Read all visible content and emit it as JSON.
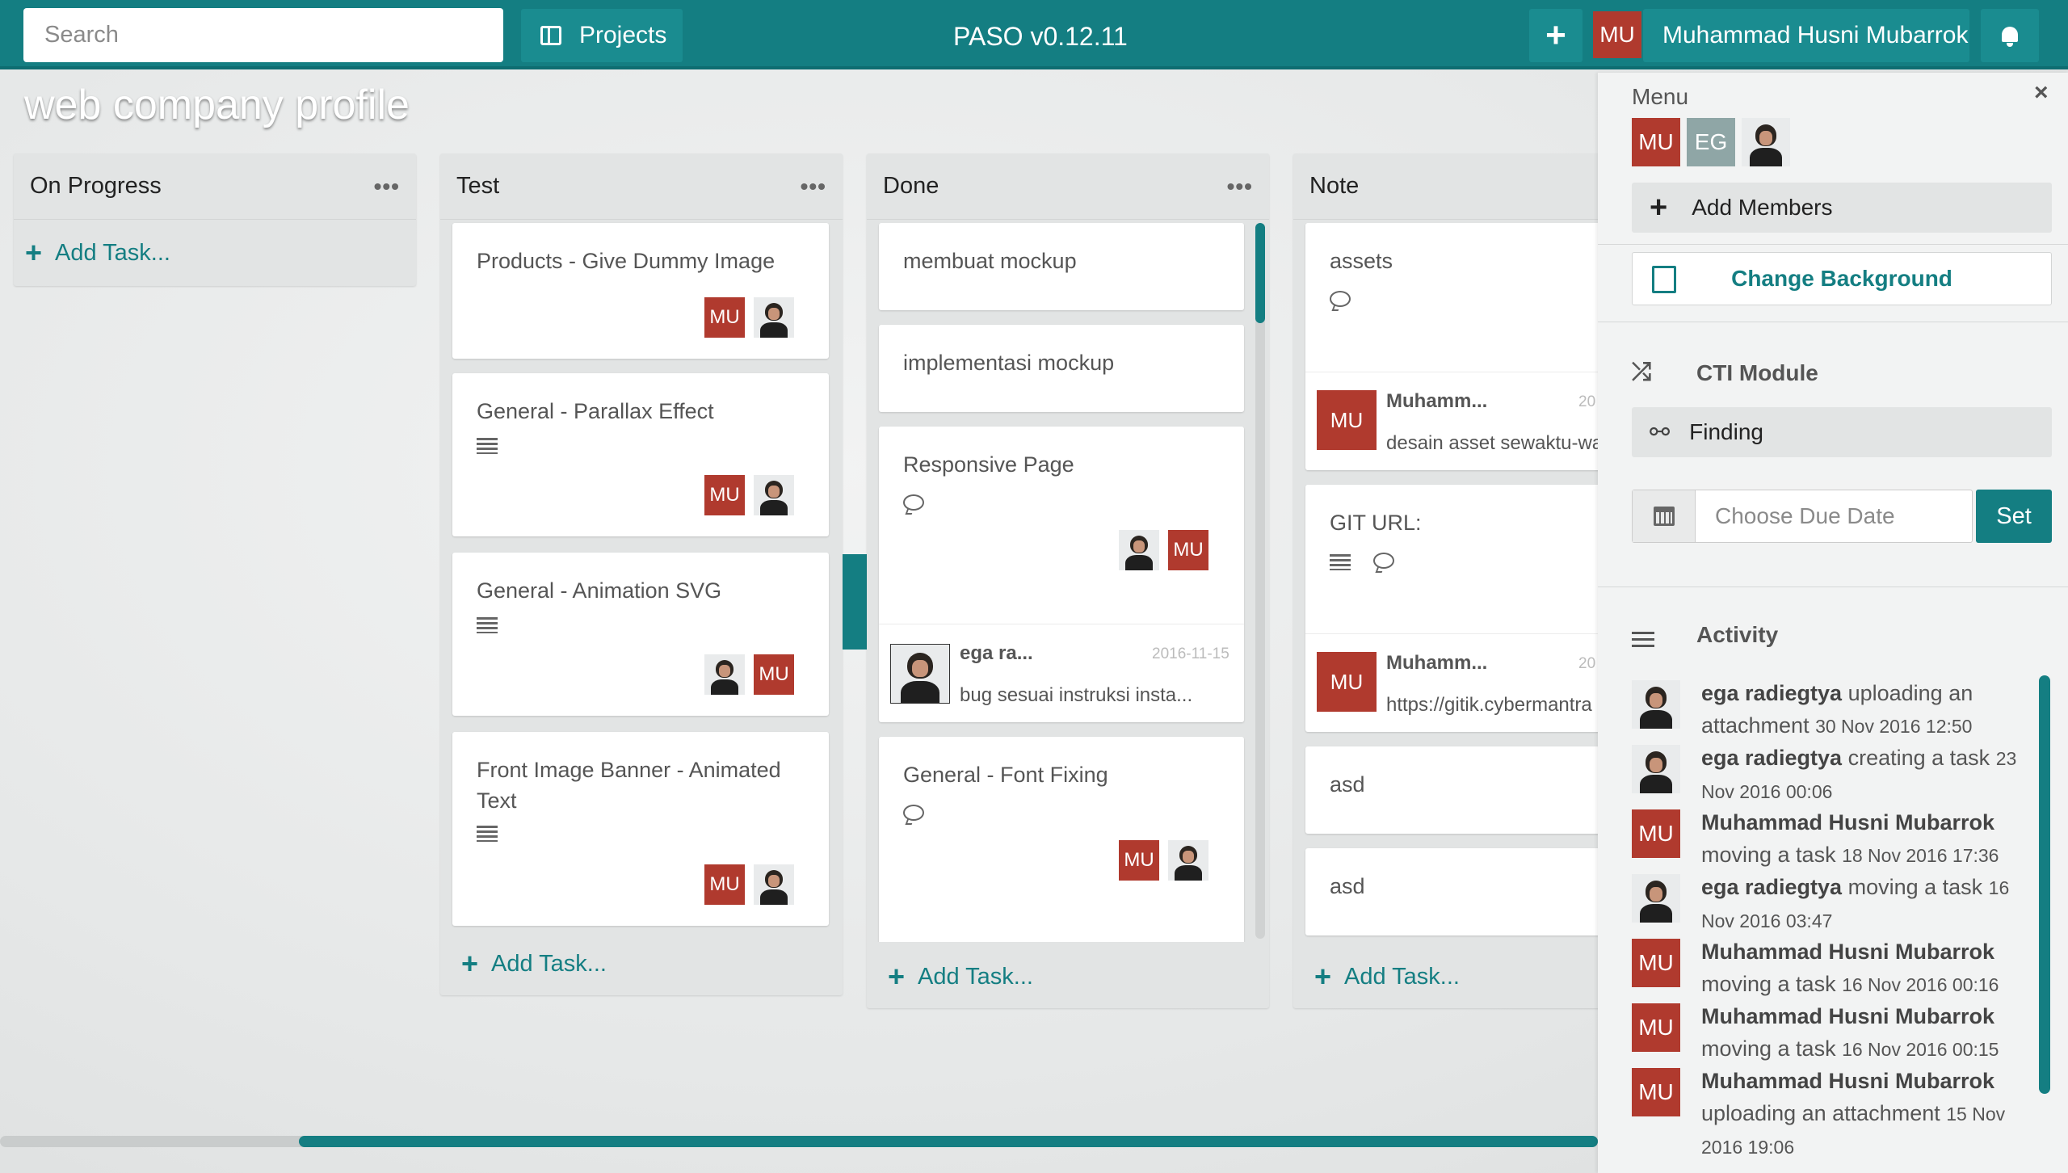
{
  "topbar": {
    "search_placeholder": "Search",
    "projects_label": "Projects",
    "app_title": "PASO v0.12.11",
    "plus_label": "+",
    "user_initials": "MU",
    "user_name": "Muhammad Husni Mubarrok"
  },
  "board": {
    "title": "web company profile"
  },
  "lists": [
    {
      "name": "On Progress",
      "add_label": "Add Task..."
    },
    {
      "name": "Test",
      "add_label": "Add Task...",
      "cards": [
        {
          "title": "Products - Give Dummy Image"
        },
        {
          "title": "General - Parallax Effect"
        },
        {
          "title": "General - Animation SVG"
        },
        {
          "title": "Front Image Banner - Animated Text"
        }
      ]
    },
    {
      "name": "Done",
      "add_label": "Add Task...",
      "cards": [
        {
          "title": "membuat mockup"
        },
        {
          "title": "implementasi mockup"
        },
        {
          "title": "Responsive Page",
          "comment": {
            "author": "ega ra...",
            "date": "2016-11-15",
            "text": "bug sesuai instruksi insta..."
          }
        },
        {
          "title": "General - Font Fixing"
        }
      ]
    },
    {
      "name": "Note",
      "add_label": "Add Task...",
      "cards": [
        {
          "title": "assets",
          "comment": {
            "initials": "MU",
            "author": "Muhamm...",
            "date": "20",
            "text": "desain asset sewaktu-wa"
          }
        },
        {
          "title": "GIT URL:",
          "comment": {
            "initials": "MU",
            "author": "Muhamm...",
            "date": "20",
            "text": "https://gitik.cybermantra"
          }
        },
        {
          "title": "asd"
        },
        {
          "title": "asd"
        }
      ]
    }
  ],
  "avatar_initials": {
    "mu": "MU",
    "eg": "EG"
  },
  "panel": {
    "menu_label": "Menu",
    "close_label": "×",
    "add_members_label": "Add Members",
    "change_background_label": "Change Background",
    "cti_module_label": "CTI Module",
    "finding_label": "Finding",
    "due_placeholder": "Choose Due Date",
    "set_label": "Set",
    "activity_label": "Activity",
    "activities": [
      {
        "user": "ega radiegtya",
        "action": " uploading an attachment ",
        "time": "30 Nov 2016 12:50"
      },
      {
        "user": "ega radiegtya",
        "action": " creating a task ",
        "time": "23 Nov 2016 00:06"
      },
      {
        "user": "Muhammad Husni Mubarrok",
        "action": " moving a task ",
        "time": "18 Nov 2016 17:36"
      },
      {
        "user": "ega radiegtya",
        "action": " moving a task ",
        "time": "16 Nov 2016 03:47"
      },
      {
        "user": "Muhammad Husni Mubarrok",
        "action": " moving a task ",
        "time": "16 Nov 2016 00:16"
      },
      {
        "user": "Muhammad Husni Mubarrok",
        "action": " moving a task ",
        "time": "16 Nov 2016 00:15"
      },
      {
        "user": "Muhammad Husni Mubarrok",
        "action": " uploading an attachment ",
        "time": "15 Nov 2016 19:06"
      }
    ]
  },
  "colors": {
    "accent": "#147e82",
    "avatar_red": "#b03a2e",
    "avatar_grey": "#8fa6a6"
  }
}
